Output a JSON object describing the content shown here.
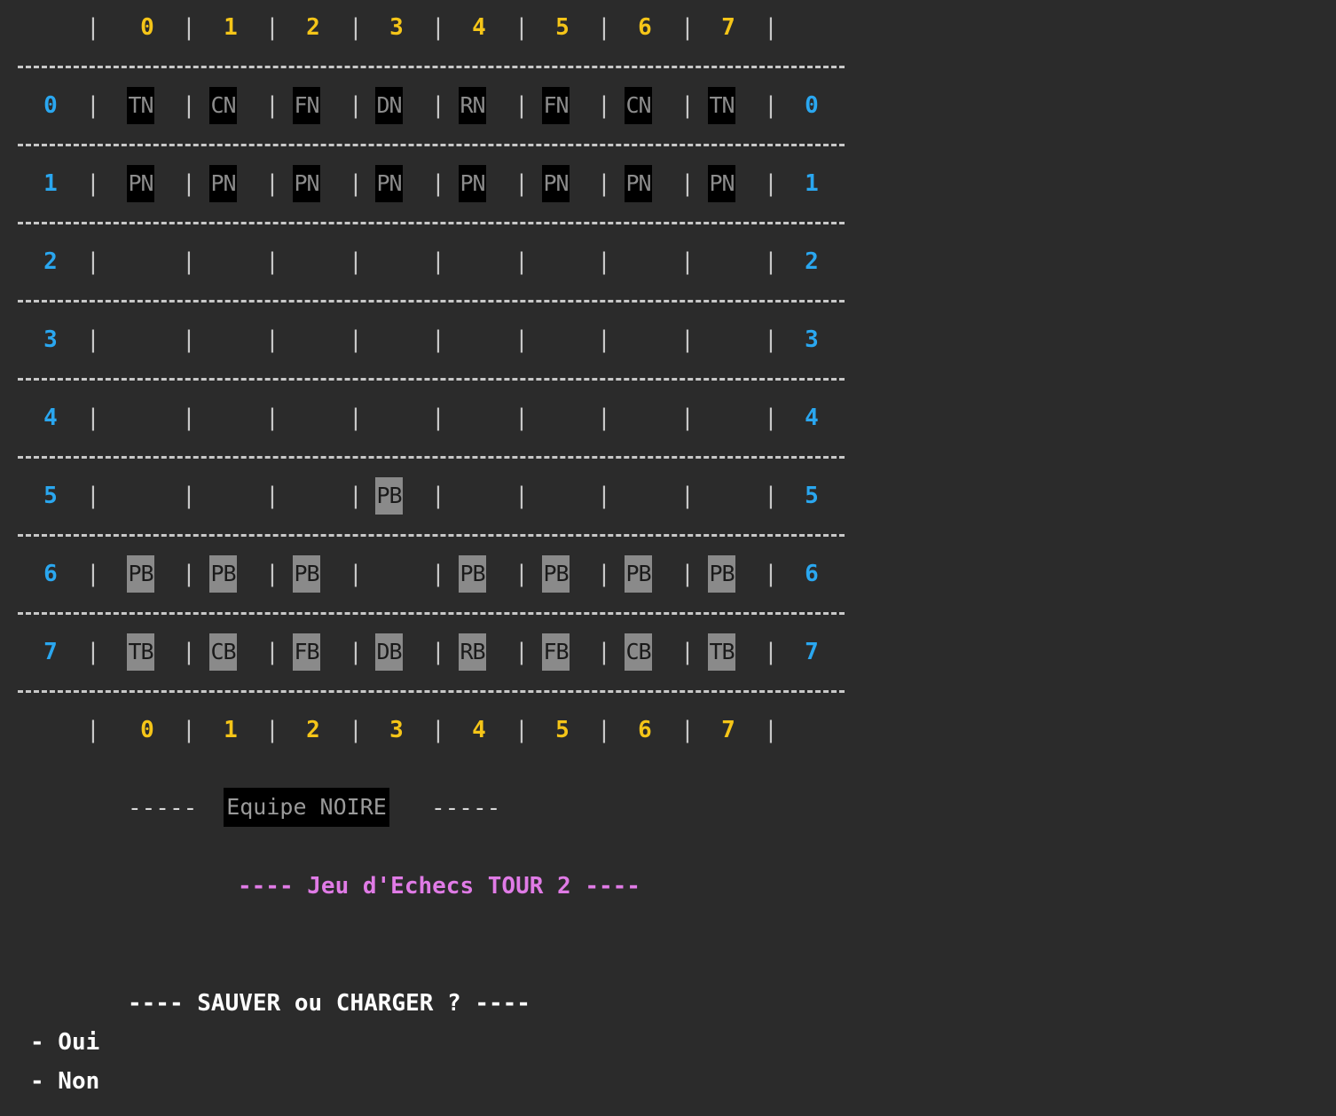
{
  "colors": {
    "background": "#2b2b2b",
    "column_label": "#f5c518",
    "row_label": "#2aa7f0",
    "black_piece_bg": "#000000",
    "white_piece_bg": "#8a8a8a",
    "title": "#e07be6"
  },
  "board": {
    "columns": [
      "0",
      "1",
      "2",
      "3",
      "4",
      "5",
      "6",
      "7"
    ],
    "rows": [
      "0",
      "1",
      "2",
      "3",
      "4",
      "5",
      "6",
      "7"
    ],
    "cells": [
      [
        "TN",
        "CN",
        "FN",
        "DN",
        "RN",
        "FN",
        "CN",
        "TN"
      ],
      [
        "PN",
        "PN",
        "PN",
        "PN",
        "PN",
        "PN",
        "PN",
        "PN"
      ],
      [
        "",
        "",
        "",
        "",
        "",
        "",
        "",
        ""
      ],
      [
        "",
        "",
        "",
        "",
        "",
        "",
        "",
        ""
      ],
      [
        "",
        "",
        "",
        "",
        "",
        "",
        "",
        ""
      ],
      [
        "",
        "",
        "",
        "PB",
        "",
        "",
        "",
        ""
      ],
      [
        "PB",
        "PB",
        "PB",
        "",
        "PB",
        "PB",
        "PB",
        "PB"
      ],
      [
        "TB",
        "CB",
        "FB",
        "DB",
        "RB",
        "FB",
        "CB",
        "TB"
      ]
    ]
  },
  "team": {
    "dashes": "-----",
    "label": "Equipe NOIRE"
  },
  "game": {
    "title": "---- Jeu d'Echecs TOUR 2 ----"
  },
  "menu": {
    "prompt": "---- SAUVER ou CHARGER ? ----",
    "options": [
      "- Oui",
      "- Non"
    ]
  }
}
